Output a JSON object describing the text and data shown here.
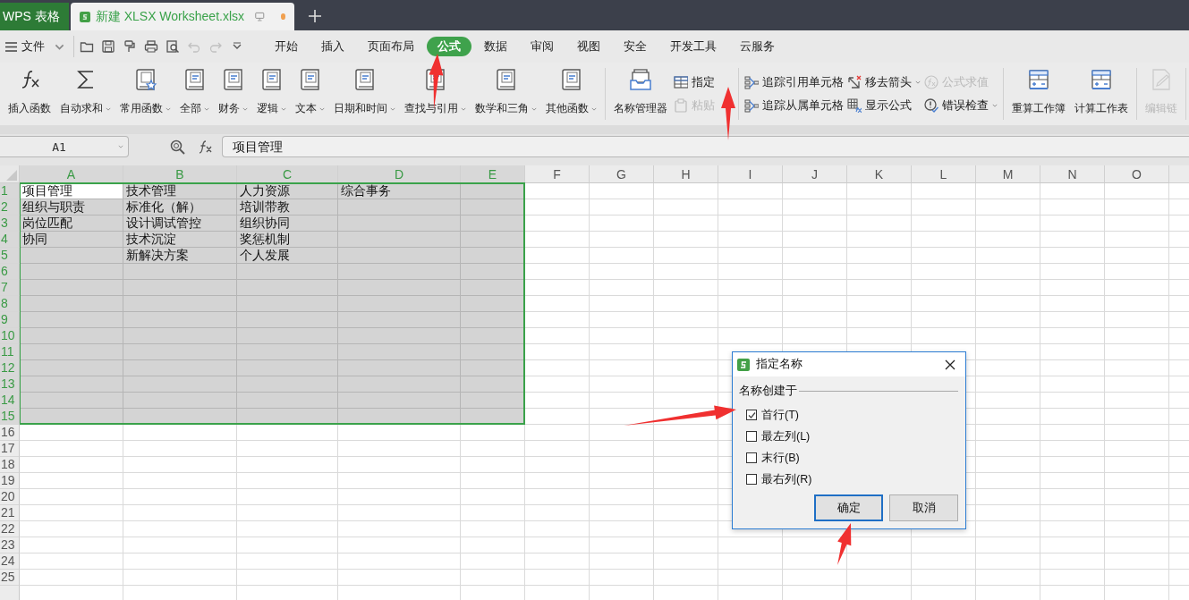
{
  "title_tabs": [
    {
      "label": "WPS 表格",
      "kind": "app",
      "selected": false
    },
    {
      "label": "新建 XLSX Worksheet.xlsx",
      "kind": "document",
      "selected": true,
      "modified": true
    }
  ],
  "menu": {
    "file_label": "文件",
    "quick_access": [
      {
        "disabled": false
      },
      {
        "disabled": false
      },
      {
        "disabled": false
      },
      {
        "disabled": false
      },
      {
        "disabled": false
      },
      {
        "disabled": true
      },
      {
        "disabled": true
      },
      {
        "disabled": false
      }
    ],
    "tabs": [
      {
        "label": "开始",
        "selected": false
      },
      {
        "label": "插入",
        "selected": false
      },
      {
        "label": "页面布局",
        "selected": false
      },
      {
        "label": "公式",
        "selected": true
      },
      {
        "label": "数据",
        "selected": false
      },
      {
        "label": "审阅",
        "selected": false
      },
      {
        "label": "视图",
        "selected": false
      },
      {
        "label": "安全",
        "selected": false
      },
      {
        "label": "开发工具",
        "selected": false
      },
      {
        "label": "云服务",
        "selected": false
      }
    ]
  },
  "ribbon": {
    "groups": [
      {
        "items": [
          {
            "kind": "large",
            "label": "插入函数",
            "dropdown": false,
            "disabled": false
          },
          {
            "kind": "large",
            "label": "自动求和",
            "dropdown": true,
            "disabled": false
          },
          {
            "kind": "large",
            "label": "常用函数",
            "dropdown": true,
            "disabled": false
          },
          {
            "kind": "large",
            "label": "全部",
            "dropdown": true,
            "disabled": false
          },
          {
            "kind": "large",
            "label": "财务",
            "dropdown": true,
            "disabled": false
          },
          {
            "kind": "large",
            "label": "逻辑",
            "dropdown": true,
            "disabled": false
          },
          {
            "kind": "large",
            "label": "文本",
            "dropdown": true,
            "disabled": false
          },
          {
            "kind": "large",
            "label": "日期和时间",
            "dropdown": true,
            "disabled": false
          },
          {
            "kind": "large",
            "label": "查找与引用",
            "dropdown": true,
            "disabled": false
          },
          {
            "kind": "large",
            "label": "数学和三角",
            "dropdown": true,
            "disabled": false
          },
          {
            "kind": "large",
            "label": "其他函数",
            "dropdown": true,
            "disabled": false
          }
        ]
      },
      {
        "items": [
          {
            "kind": "large",
            "label": "名称管理器",
            "dropdown": false,
            "disabled": false
          },
          {
            "kind": "small",
            "label": "指定",
            "dropdown": false,
            "disabled": false
          },
          {
            "kind": "small",
            "label": "粘贴",
            "dropdown": false,
            "disabled": true
          }
        ]
      },
      {
        "items": [
          {
            "kind": "small",
            "label": "追踪引用单元格",
            "dropdown": false,
            "disabled": false
          },
          {
            "kind": "small",
            "label": "追踪从属单元格",
            "dropdown": false,
            "disabled": false
          },
          {
            "kind": "small",
            "label": "移去箭头",
            "dropdown": true,
            "disabled": false
          },
          {
            "kind": "small",
            "label": "显示公式",
            "dropdown": false,
            "disabled": false
          },
          {
            "kind": "small",
            "label": "公式求值",
            "dropdown": false,
            "disabled": true
          },
          {
            "kind": "small",
            "label": "错误检查",
            "dropdown": true,
            "disabled": false
          }
        ]
      },
      {
        "items": [
          {
            "kind": "large",
            "label": "重算工作簿",
            "dropdown": false,
            "disabled": false
          },
          {
            "kind": "large",
            "label": "计算工作表",
            "dropdown": false,
            "disabled": false
          }
        ]
      },
      {
        "items": [
          {
            "kind": "large",
            "label": "编辑链",
            "dropdown": false,
            "disabled": true
          }
        ]
      }
    ]
  },
  "formula_bar": {
    "name_box": "A1",
    "formula": "项目管理"
  },
  "sheet": {
    "columns": [
      {
        "label": "A",
        "selected": true
      },
      {
        "label": "B",
        "selected": true
      },
      {
        "label": "C",
        "selected": true
      },
      {
        "label": "D",
        "selected": true
      },
      {
        "label": "E",
        "selected": true
      },
      {
        "label": "F",
        "selected": false
      },
      {
        "label": "G",
        "selected": false
      },
      {
        "label": "H",
        "selected": false
      },
      {
        "label": "I",
        "selected": false
      },
      {
        "label": "J",
        "selected": false
      },
      {
        "label": "K",
        "selected": false
      },
      {
        "label": "L",
        "selected": false
      },
      {
        "label": "M",
        "selected": false
      },
      {
        "label": "N",
        "selected": false
      },
      {
        "label": "O",
        "selected": false
      }
    ],
    "rows": [
      {
        "label": "1",
        "selected": true,
        "cells": [
          "项目管理",
          "技术管理",
          "人力资源",
          "综合事务"
        ]
      },
      {
        "label": "2",
        "selected": true,
        "cells": [
          "组织与职责",
          "标准化（解）",
          "培训带教"
        ]
      },
      {
        "label": "3",
        "selected": true,
        "cells": [
          "岗位匹配",
          "设计调试管控",
          "组织协同"
        ]
      },
      {
        "label": "4",
        "selected": true,
        "cells": [
          "协同",
          "技术沉淀",
          "奖惩机制"
        ]
      },
      {
        "label": "5",
        "selected": true,
        "cells": [
          null,
          "新解决方案",
          "个人发展"
        ]
      },
      {
        "label": "6",
        "selected": true
      },
      {
        "label": "7",
        "selected": true
      },
      {
        "label": "8",
        "selected": true
      },
      {
        "label": "9",
        "selected": true
      },
      {
        "label": "10",
        "selected": true
      },
      {
        "label": "11",
        "selected": true
      },
      {
        "label": "12",
        "selected": true
      },
      {
        "label": "13",
        "selected": true
      },
      {
        "label": "14",
        "selected": true
      },
      {
        "label": "15",
        "selected": true
      },
      {
        "label": "16",
        "selected": false
      },
      {
        "label": "17",
        "selected": false
      },
      {
        "label": "18",
        "selected": false
      },
      {
        "label": "19",
        "selected": false
      },
      {
        "label": "20",
        "selected": false
      },
      {
        "label": "21",
        "selected": false
      },
      {
        "label": "22",
        "selected": false
      },
      {
        "label": "23",
        "selected": false
      },
      {
        "label": "24",
        "selected": false
      },
      {
        "label": "25",
        "selected": false
      }
    ]
  },
  "dialog": {
    "title": "指定名称",
    "group_label": "名称创建于",
    "options": [
      {
        "label": "首行(T)",
        "checked": true
      },
      {
        "label": "最左列(L)",
        "checked": false
      },
      {
        "label": "末行(B)",
        "checked": false
      },
      {
        "label": "最右列(R)",
        "checked": false
      }
    ],
    "buttons": [
      {
        "label": "确定",
        "default": true
      },
      {
        "label": "取消",
        "default": false
      }
    ]
  }
}
